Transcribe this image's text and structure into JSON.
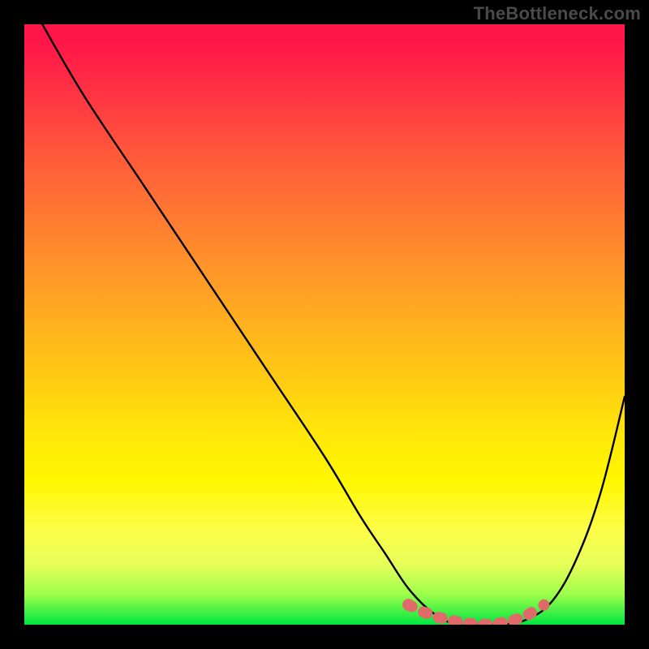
{
  "watermark": "TheBottleneck.com",
  "chart_data": {
    "type": "line",
    "title": "",
    "xlabel": "",
    "ylabel": "",
    "xlim": [
      0,
      100
    ],
    "ylim": [
      0,
      100
    ],
    "grid": false,
    "legend": false,
    "series": [
      {
        "name": "bottleneck-curve",
        "color": "#000000",
        "x": [
          3,
          10,
          20,
          30,
          40,
          50,
          56,
          60,
          64,
          68,
          72,
          76,
          80,
          84,
          88,
          92,
          96,
          100
        ],
        "y": [
          100,
          88,
          73,
          58,
          43,
          28,
          18,
          12,
          6,
          2,
          0,
          0,
          0,
          1,
          4,
          11,
          22,
          38
        ]
      }
    ],
    "highlight": {
      "name": "optimal-range",
      "color": "#e06a6a",
      "style": "thick-dashed",
      "x": [
        64,
        66.5,
        69,
        71.5,
        74,
        76.5,
        79,
        81.5,
        84,
        86
      ],
      "y": [
        3.3,
        2.1,
        1.2,
        0.6,
        0.2,
        0.0,
        0.2,
        0.7,
        1.7,
        3.0
      ]
    },
    "gradient_background": {
      "orientation": "vertical",
      "stops": [
        {
          "pos": 0.0,
          "color": "#ff1648"
        },
        {
          "pos": 0.22,
          "color": "#ff5a3a"
        },
        {
          "pos": 0.46,
          "color": "#ffa523"
        },
        {
          "pos": 0.68,
          "color": "#ffe60a"
        },
        {
          "pos": 0.84,
          "color": "#fdfd47"
        },
        {
          "pos": 0.95,
          "color": "#9cff4a"
        },
        {
          "pos": 1.0,
          "color": "#00e642"
        }
      ]
    }
  }
}
